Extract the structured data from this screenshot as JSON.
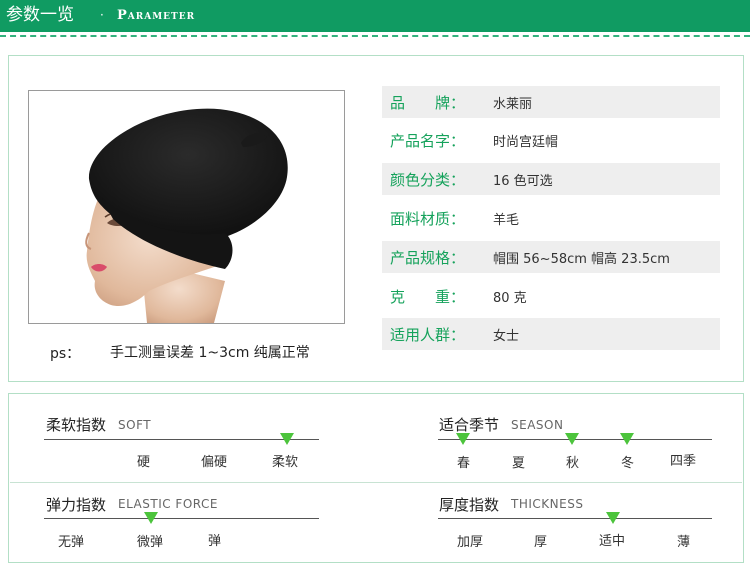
{
  "header": {
    "title": "参数一览",
    "dot": "·",
    "subtitle": "Parameter"
  },
  "product": {
    "ps_label": "ps：",
    "ps_text": "手工测量误差 1~3cm 纯属正常"
  },
  "specs": [
    {
      "label": "品　　牌：",
      "value": "水莱丽"
    },
    {
      "label": "产品名字：",
      "value": "时尚宫廷帽"
    },
    {
      "label": "颜色分类：",
      "value": "16 色可选"
    },
    {
      "label": "面料材质：",
      "value": "羊毛"
    },
    {
      "label": "产品规格：",
      "value": "帽围 56~58cm  帽高 23.5cm"
    },
    {
      "label": "克　　重：",
      "value": "80 克"
    },
    {
      "label": "适用人群：",
      "value": "女士"
    }
  ],
  "attributes": {
    "softness": {
      "name": "柔软指数",
      "en": "SOFT",
      "options": [
        "硬",
        "偏硬",
        "柔软"
      ],
      "selected": [
        "柔软"
      ]
    },
    "season": {
      "name": "适合季节",
      "en": "SEASON",
      "options": [
        "春",
        "夏",
        "秋",
        "冬",
        "四季"
      ],
      "selected": [
        "春",
        "秋",
        "冬"
      ]
    },
    "elasticity": {
      "name": "弹力指数",
      "en": "ELASTIC FORCE",
      "options": [
        "无弹",
        "微弹",
        "弹"
      ],
      "selected": [
        "微弹"
      ]
    },
    "thickness": {
      "name": "厚度指数",
      "en": "THICKNESS",
      "options": [
        "加厚",
        "厚",
        "适中",
        "薄"
      ],
      "selected": [
        "适中"
      ]
    }
  },
  "colors": {
    "brand_green": "#109b62",
    "label_green": "#15a25b",
    "marker_green": "#4cc43c"
  },
  "icons": {
    "marker": "down-triangle-marker-icon"
  }
}
